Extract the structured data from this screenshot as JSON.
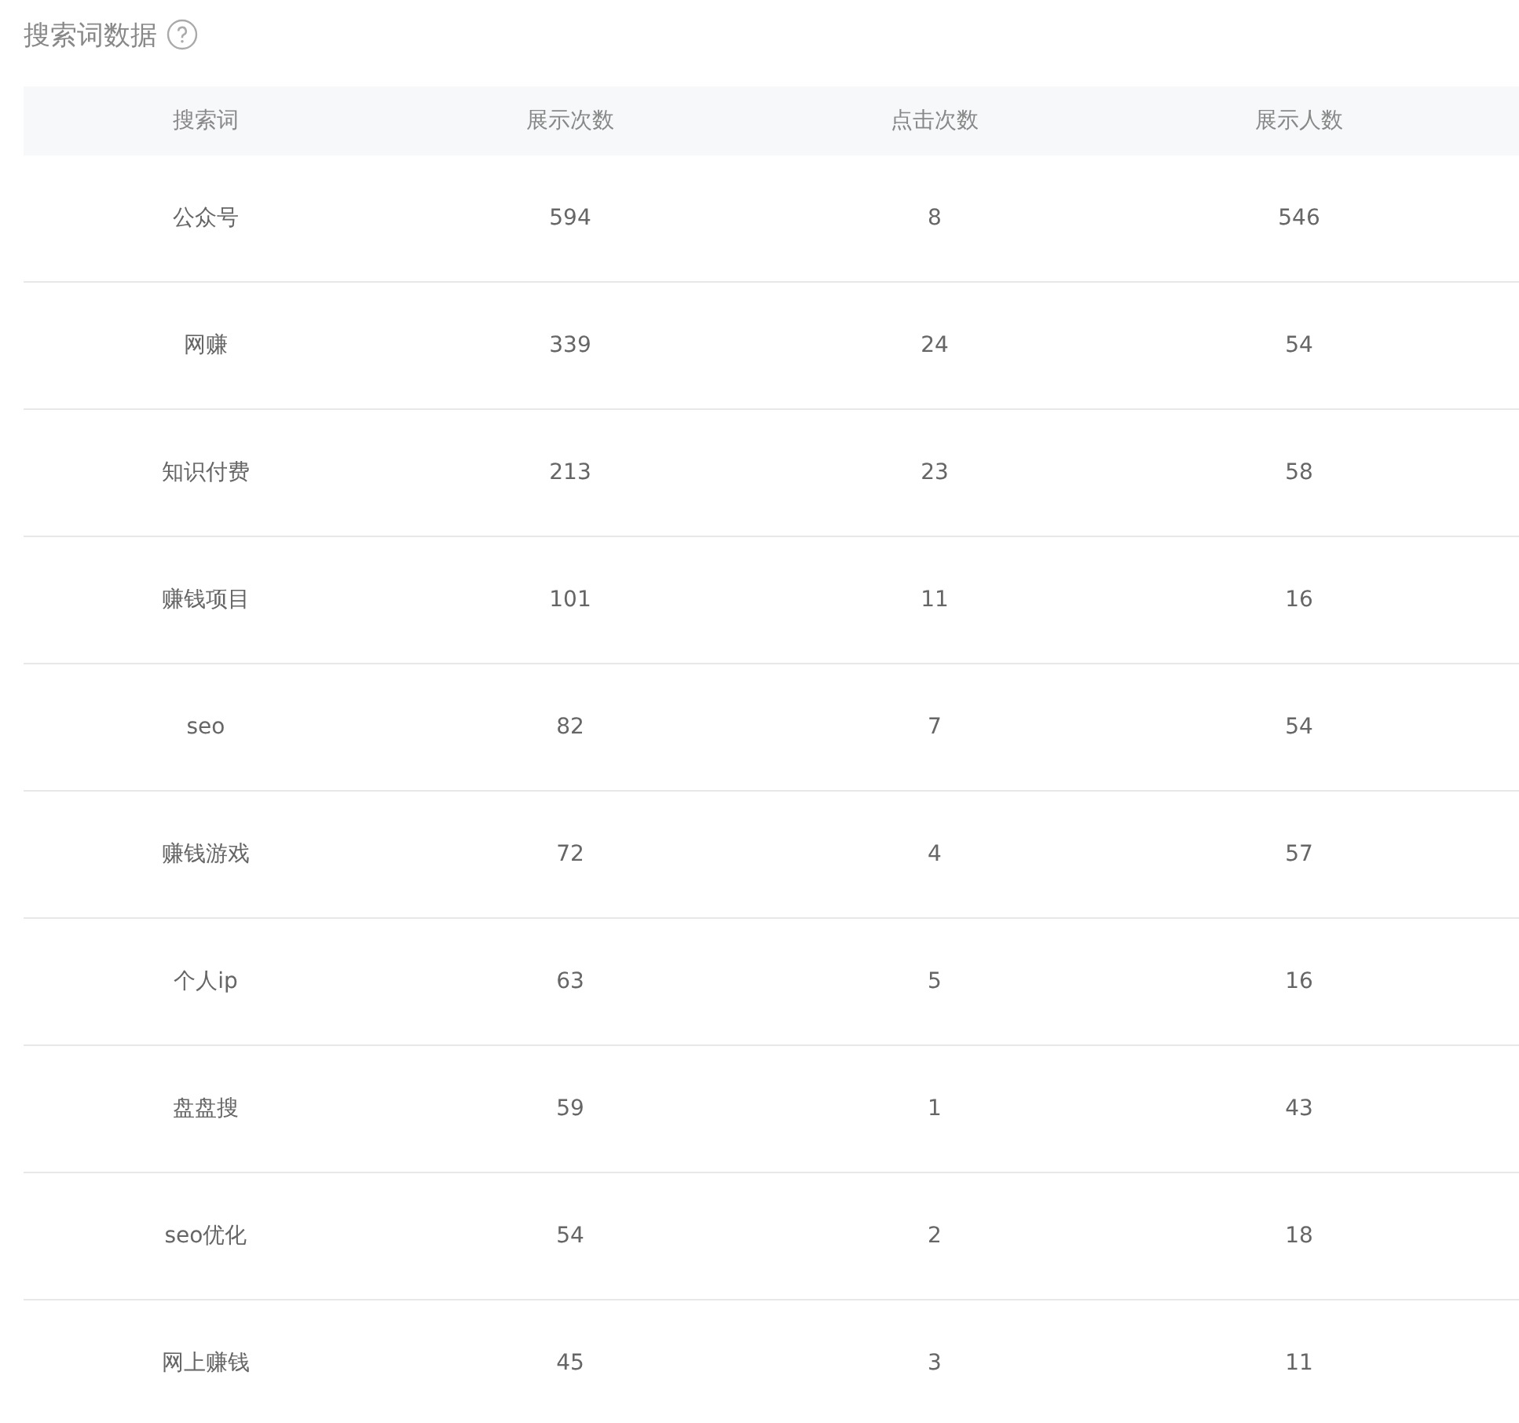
{
  "title": "搜索词数据",
  "table": {
    "columns": [
      "搜索词",
      "展示次数",
      "点击次数",
      "展示人数"
    ],
    "rows": [
      [
        "公众号",
        "594",
        "8",
        "546"
      ],
      [
        "网赚",
        "339",
        "24",
        "54"
      ],
      [
        "知识付费",
        "213",
        "23",
        "58"
      ],
      [
        "赚钱项目",
        "101",
        "11",
        "16"
      ],
      [
        "seo",
        "82",
        "7",
        "54"
      ],
      [
        "赚钱游戏",
        "72",
        "4",
        "57"
      ],
      [
        "个人ip",
        "63",
        "5",
        "16"
      ],
      [
        "盘盘搜",
        "59",
        "1",
        "43"
      ],
      [
        "seo优化",
        "54",
        "2",
        "18"
      ],
      [
        "网上赚钱",
        "45",
        "3",
        "11"
      ]
    ]
  }
}
